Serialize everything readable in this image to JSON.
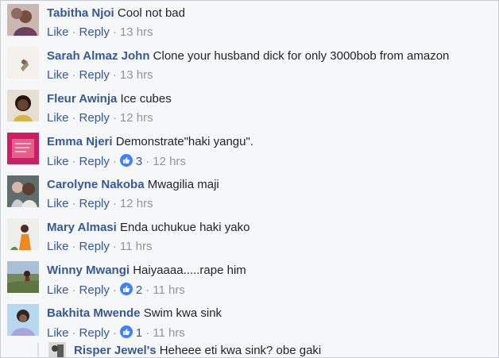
{
  "comments": [
    {
      "author": "Tabitha Njoi",
      "text": "Cool not bad",
      "like": "Like",
      "reply": "Reply",
      "sep1": "·",
      "sep2": "·",
      "sep3": "·",
      "likes": "",
      "time": "13 hrs",
      "avatar": "avatar-photo"
    },
    {
      "author": "Sarah Almaz John",
      "text": "Clone your husband dick for only 3000bob from amazon",
      "like": "Like",
      "reply": "Reply",
      "sep1": "·",
      "sep2": "·",
      "sep3": "·",
      "likes": "",
      "time": "13 hrs",
      "avatar": "avatar-photo"
    },
    {
      "author": "Fleur Awinja",
      "text": "Ice cubes",
      "like": "Like",
      "reply": "Reply",
      "sep1": "·",
      "sep2": "·",
      "sep3": "·",
      "likes": "",
      "time": "12 hrs",
      "avatar": "avatar-photo"
    },
    {
      "author": "Emma Njeri",
      "text": "Demonstrate\"haki yangu\".",
      "like": "Like",
      "reply": "Reply",
      "sep1": "·",
      "sep2": "·",
      "sep3": "·",
      "likes": "3",
      "time": "12 hrs",
      "avatar": "avatar-photo"
    },
    {
      "author": "Carolyne Nakoba",
      "text": "Mwagilia maji",
      "like": "Like",
      "reply": "Reply",
      "sep1": "·",
      "sep2": "·",
      "sep3": "·",
      "likes": "",
      "time": "12 hrs",
      "avatar": "avatar-photo"
    },
    {
      "author": "Mary Almasi",
      "text": "Enda uchukue haki yako",
      "like": "Like",
      "reply": "Reply",
      "sep1": "·",
      "sep2": "·",
      "sep3": "·",
      "likes": "",
      "time": "11 hrs",
      "avatar": "avatar-photo"
    },
    {
      "author": "Winny Mwangi",
      "text": "Haiyaaaa.....rape him",
      "like": "Like",
      "reply": "Reply",
      "sep1": "·",
      "sep2": "·",
      "sep3": "·",
      "likes": "2",
      "time": "11 hrs",
      "avatar": "avatar-photo"
    },
    {
      "author": "Bakhita Mwende",
      "text": "Swim kwa sink",
      "like": "Like",
      "reply": "Reply",
      "sep1": "·",
      "sep2": "·",
      "sep3": "·",
      "likes": "1",
      "time": "11 hrs",
      "avatar": "avatar-photo"
    }
  ],
  "reply": {
    "author": "Risper Jewel's",
    "text": "Heheee eti kwa sink? obe gaki"
  },
  "colors": {
    "author": "#365899",
    "muted": "#90949c",
    "like_icon": "#4080ff",
    "background": "#f6f7f9"
  }
}
